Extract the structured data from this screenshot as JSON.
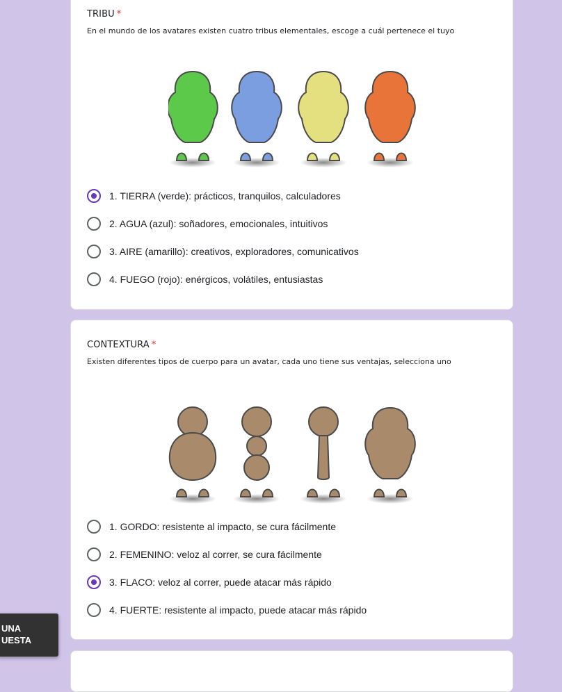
{
  "questions": [
    {
      "title": "TRIBU",
      "required_mark": "*",
      "description": "En el mundo de los avatares existen cuatro tribus elementales, escoge a cuál pertenece el tuyo",
      "image_figures": [
        "green",
        "blue",
        "yellow",
        "orange"
      ],
      "options": [
        {
          "label": "1. TIERRA (verde): prácticos, tranquilos, calculadores",
          "checked": true
        },
        {
          "label": "2. AGUA (azul): soñadores, emocionales, intuitivos",
          "checked": false
        },
        {
          "label": "3. AIRE (amarillo): creativos, exploradores, comunicativos",
          "checked": false
        },
        {
          "label": "4. FUEGO (rojo): enérgicos, volátiles, entusiastas",
          "checked": false
        }
      ]
    },
    {
      "title": "CONTEXTURA",
      "required_mark": "*",
      "description": "Existen diferentes tipos de cuerpo para un avatar, cada uno tiene sus ventajas, selecciona uno",
      "image_figures": [
        "gordo",
        "femenino",
        "flaco",
        "fuerte"
      ],
      "options": [
        {
          "label": "1. GORDO: resistente al impacto, se cura fácilmente",
          "checked": false
        },
        {
          "label": "2. FEMENINO: veloz al correr, se cura fácilmente",
          "checked": false
        },
        {
          "label": "3. FLACO: veloz al correr, puede atacar más rápido",
          "checked": true
        },
        {
          "label": "4. FUERTE: resistente al impacto, puede atacar más rápido",
          "checked": false
        }
      ]
    }
  ],
  "toast": {
    "line1": "UNA",
    "line2": "UESTA"
  },
  "colors": {
    "background": "#d1c4e9",
    "accent": "#673ab7",
    "required": "#d93025",
    "green": "#5cc94a",
    "blue": "#7a9ee0",
    "yellow": "#e5e07f",
    "orange": "#e8743a",
    "skin": "#a98a6a"
  }
}
